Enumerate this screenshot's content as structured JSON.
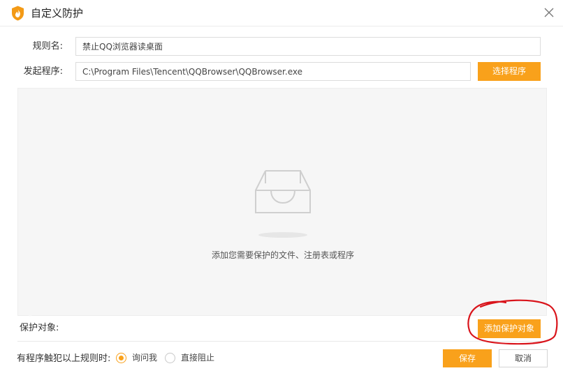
{
  "window": {
    "title": "自定义防护",
    "logo_icon": "flame-shield-icon",
    "close_icon": "close-icon"
  },
  "form": {
    "rule_name_label": "规则名:",
    "rule_name_value": "禁止QQ浏览器读桌面",
    "program_label": "发起程序:",
    "program_value": "C:\\Program Files\\Tencent\\QQBrowser\\QQBrowser.exe",
    "choose_program_button": "选择程序"
  },
  "protected_area": {
    "empty_icon": "empty-tray-icon",
    "empty_hint": "添加您需要保护的文件、注册表或程序",
    "label": "保护对象:",
    "add_button": "添加保护对象"
  },
  "footer": {
    "trigger_label": "有程序触犯以上规则时:",
    "options": [
      {
        "label": "询问我",
        "checked": true
      },
      {
        "label": "直接阻止",
        "checked": false
      }
    ],
    "save_button": "保存",
    "cancel_button": "取消"
  },
  "colors": {
    "accent": "#f9a11b",
    "annotation": "#d9141b"
  }
}
